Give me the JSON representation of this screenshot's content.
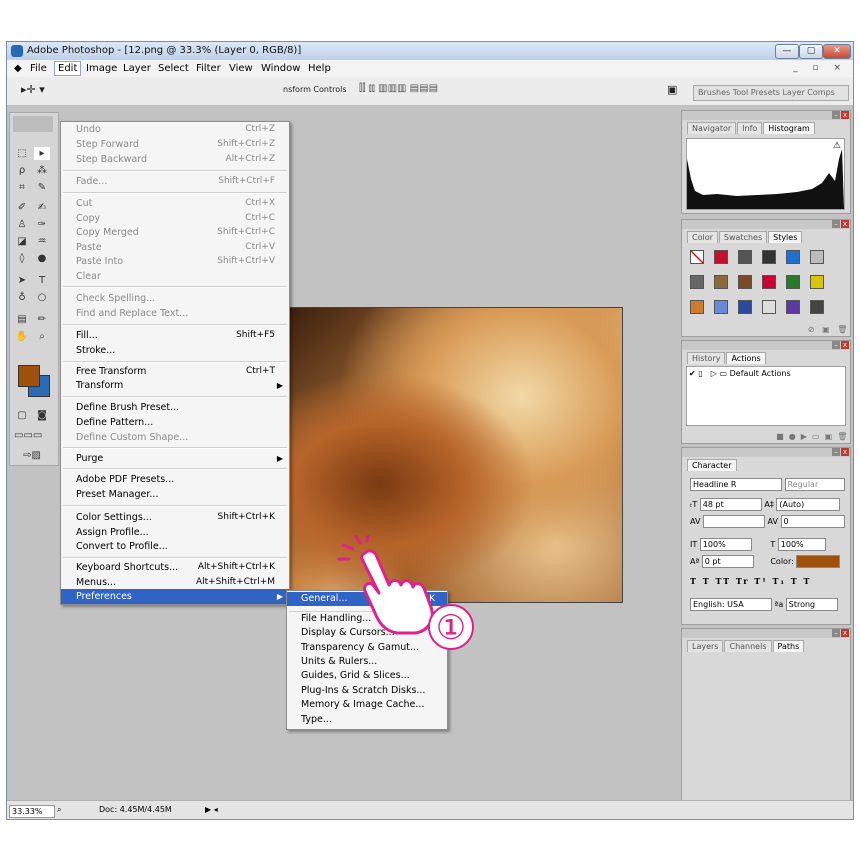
{
  "window": {
    "title": "Adobe Photoshop - [12.png @ 33.3% (Layer 0, RGB/8)]",
    "controls": {
      "minimize": "—",
      "maximize": "▢",
      "close": "✕"
    }
  },
  "menubar": {
    "items": [
      "File",
      "Edit",
      "Image",
      "Layer",
      "Select",
      "Filter",
      "View",
      "Window",
      "Help"
    ],
    "active": "Edit"
  },
  "options_bar": {
    "transform_text": "nsform Controls",
    "palette_tabs_text": "Brushes  Tool Presets  Layer Comps"
  },
  "edit_menu": {
    "items": [
      {
        "label": "Undo",
        "shortcut": "Ctrl+Z",
        "disabled": true
      },
      {
        "label": "Step Forward",
        "shortcut": "Shift+Ctrl+Z",
        "disabled": true
      },
      {
        "label": "Step Backward",
        "shortcut": "Alt+Ctrl+Z",
        "disabled": true
      },
      {
        "label": "Fade...",
        "shortcut": "Shift+Ctrl+F",
        "disabled": true
      },
      {
        "label": "Cut",
        "shortcut": "Ctrl+X",
        "disabled": true
      },
      {
        "label": "Copy",
        "shortcut": "Ctrl+C",
        "disabled": true
      },
      {
        "label": "Copy Merged",
        "shortcut": "Shift+Ctrl+C",
        "disabled": true
      },
      {
        "label": "Paste",
        "shortcut": "Ctrl+V",
        "disabled": true
      },
      {
        "label": "Paste Into",
        "shortcut": "Shift+Ctrl+V",
        "disabled": true
      },
      {
        "label": "Clear",
        "shortcut": "",
        "disabled": true
      },
      {
        "label": "Check Spelling...",
        "shortcut": "",
        "disabled": true
      },
      {
        "label": "Find and Replace Text...",
        "shortcut": "",
        "disabled": true
      },
      {
        "label": "Fill...",
        "shortcut": "Shift+F5",
        "disabled": false
      },
      {
        "label": "Stroke...",
        "shortcut": "",
        "disabled": false
      },
      {
        "label": "Free Transform",
        "shortcut": "Ctrl+T",
        "disabled": false
      },
      {
        "label": "Transform",
        "shortcut": "",
        "disabled": false,
        "submenu": true
      },
      {
        "label": "Define Brush Preset...",
        "shortcut": "",
        "disabled": false
      },
      {
        "label": "Define Pattern...",
        "shortcut": "",
        "disabled": false
      },
      {
        "label": "Define Custom Shape...",
        "shortcut": "",
        "disabled": true
      },
      {
        "label": "Purge",
        "shortcut": "",
        "disabled": false,
        "submenu": true
      },
      {
        "label": "Adobe PDF Presets...",
        "shortcut": "",
        "disabled": false
      },
      {
        "label": "Preset Manager...",
        "shortcut": "",
        "disabled": false
      },
      {
        "label": "Color Settings...",
        "shortcut": "Shift+Ctrl+K",
        "disabled": false
      },
      {
        "label": "Assign Profile...",
        "shortcut": "",
        "disabled": false
      },
      {
        "label": "Convert to Profile...",
        "shortcut": "",
        "disabled": false
      },
      {
        "label": "Keyboard Shortcuts...",
        "shortcut": "Alt+Shift+Ctrl+K",
        "disabled": false
      },
      {
        "label": "Menus...",
        "shortcut": "Alt+Shift+Ctrl+M",
        "disabled": false
      },
      {
        "label": "Preferences",
        "shortcut": "",
        "disabled": false,
        "submenu": true,
        "highlighted": true
      }
    ]
  },
  "preferences_submenu": {
    "items": [
      {
        "label": "General...",
        "shortcut": "Ctrl+K",
        "highlighted": true
      },
      {
        "label": "File Handling..."
      },
      {
        "label": "Display & Cursors..."
      },
      {
        "label": "Transparency & Gamut..."
      },
      {
        "label": "Units & Rulers..."
      },
      {
        "label": "Guides, Grid & Slices..."
      },
      {
        "label": "Plug-Ins & Scratch Disks..."
      },
      {
        "label": "Memory & Image Cache..."
      },
      {
        "label": "Type..."
      }
    ]
  },
  "panels": {
    "navigator": {
      "tabs": [
        "Navigator",
        "Info",
        "Histogram"
      ],
      "active": "Histogram"
    },
    "styles": {
      "tabs": [
        "Color",
        "Swatches",
        "Styles"
      ],
      "active": "Styles"
    },
    "actions": {
      "tabs": [
        "History",
        "Actions"
      ],
      "active": "Actions",
      "row_label": "Default Actions"
    },
    "character": {
      "tab": "Character",
      "font_family": "Headline R",
      "font_style": "Regular",
      "size": "48 pt",
      "leading": "(Auto)",
      "tracking": "0",
      "vertical_scale": "100%",
      "horizontal_scale": "100%",
      "baseline": "0 pt",
      "color_label": "Color:",
      "color": "#a0520c",
      "language": "English: USA",
      "antialias": "Strong"
    },
    "layers": {
      "tabs": [
        "Layers",
        "Channels",
        "Paths"
      ],
      "active": "Paths"
    }
  },
  "status_bar": {
    "zoom": "33.33%",
    "doc": "Doc: 4.45M/4.45M"
  },
  "annotation": {
    "step_number": "①"
  },
  "colors": {
    "foreground": "#a0520c",
    "background": "#2b6bb5",
    "highlight": "#2f63c4",
    "annotation": "#e0218a"
  }
}
